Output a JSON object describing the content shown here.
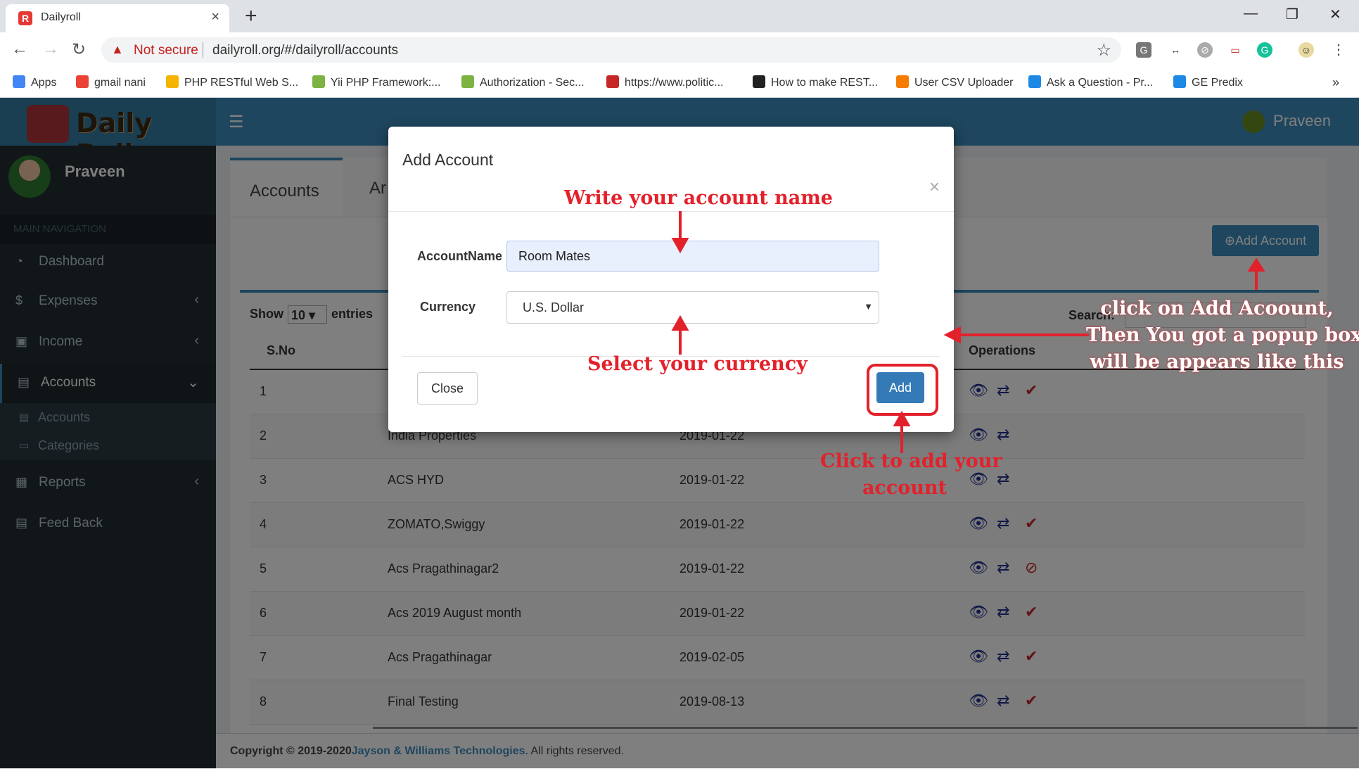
{
  "browser": {
    "tab_title": "Dailyroll",
    "tab_close": "×",
    "new_tab": "+",
    "warning_text": "Not secure",
    "url": "dailyroll.org/#/dailyroll/accounts",
    "bookmarks": [
      {
        "label": "Apps",
        "color": "#4285f4"
      },
      {
        "label": "gmail nani",
        "color": "#ea4335"
      },
      {
        "label": "PHP RESTful Web S...",
        "color": "#f4b400"
      },
      {
        "label": "Yii PHP Framework:...",
        "color": "#7cb342"
      },
      {
        "label": "Authorization - Sec...",
        "color": "#7cb342"
      },
      {
        "label": "https://www.politic...",
        "color": "#c62828"
      },
      {
        "label": "How to make REST...",
        "color": "#222222"
      },
      {
        "label": "User CSV Uploader",
        "color": "#f57c00"
      },
      {
        "label": "Ask a Question - Pr...",
        "color": "#1e88e5"
      },
      {
        "label": "GE Predix",
        "color": "#1e88e5"
      }
    ],
    "more": "»"
  },
  "app": {
    "logo_text": "Daily Roll",
    "user_name": "Praveen",
    "nav_header": "MAIN NAVIGATION",
    "nav": [
      {
        "label": "Dashboard",
        "icon": "dashboard-icon",
        "glyph": "◔"
      },
      {
        "label": "Expenses",
        "icon": "dollar-icon",
        "glyph": "$"
      },
      {
        "label": "Income",
        "icon": "money-icon",
        "glyph": "▣"
      },
      {
        "label": "Accounts",
        "icon": "book-icon",
        "glyph": "▤"
      },
      {
        "label": "Reports",
        "icon": "grid-icon",
        "glyph": "▦"
      },
      {
        "label": "Feed Back",
        "icon": "book-icon",
        "glyph": "▤"
      }
    ],
    "subnav": [
      {
        "label": "Accounts",
        "glyph": "▤"
      },
      {
        "label": "Categories",
        "glyph": "▭"
      }
    ]
  },
  "content": {
    "tab_accounts": "Accounts",
    "tab_second_partial": "Ar",
    "add_account_button": "Add Account",
    "show_label": "Show",
    "entries_value": "10",
    "entries_label": "entries",
    "search_label": "Search:",
    "columns": [
      "S.No",
      "Operations"
    ],
    "rows": [
      {
        "sno": "1",
        "name": "",
        "date": "",
        "ops": [
          "eye",
          "swap",
          "check"
        ]
      },
      {
        "sno": "2",
        "name": "India Properties",
        "date": "2019-01-22",
        "ops": [
          "eye",
          "swap"
        ]
      },
      {
        "sno": "3",
        "name": "ACS HYD",
        "date": "2019-01-22",
        "ops": [
          "eye",
          "swap"
        ]
      },
      {
        "sno": "4",
        "name": "ZOMATO,Swiggy",
        "date": "2019-01-22",
        "ops": [
          "eye",
          "swap",
          "check"
        ]
      },
      {
        "sno": "5",
        "name": "Acs Pragathinagar2",
        "date": "2019-01-22",
        "ops": [
          "eye",
          "swap",
          "ban"
        ]
      },
      {
        "sno": "6",
        "name": "Acs 2019 August month",
        "date": "2019-01-22",
        "ops": [
          "eye",
          "swap",
          "check"
        ]
      },
      {
        "sno": "7",
        "name": "Acs Pragathinagar",
        "date": "2019-02-05",
        "ops": [
          "eye",
          "swap",
          "check"
        ]
      },
      {
        "sno": "8",
        "name": "Final Testing",
        "date": "2019-08-13",
        "ops": [
          "eye",
          "swap",
          "check"
        ]
      }
    ]
  },
  "footer": {
    "prefix": "Copyright © 2019-2020",
    "company": "Jayson & Williams Technologies",
    "suffix": ". All rights reserved."
  },
  "modal": {
    "title": "Add Account",
    "close_icon": "×",
    "account_label": "AccountName",
    "account_value": "Room Mates",
    "currency_label": "Currency",
    "currency_value": "U.S. Dollar",
    "close_button": "Close",
    "add_button": "Add"
  },
  "annotations": {
    "write_name": "Write your account name",
    "select_currency": "Select your currency",
    "click_add_1": "Click to add your",
    "click_add_2": "account",
    "side_1": "click on Add Acoount,",
    "side_2": "Then You got a popup box",
    "side_3": "will be appears like this",
    "color": "#e3212b"
  }
}
